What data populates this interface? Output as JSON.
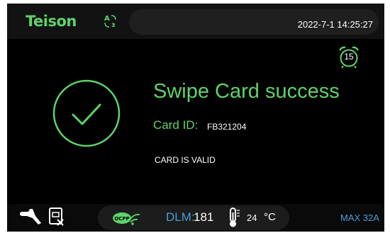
{
  "header": {
    "brand": "Teison",
    "datetime": "2022-7-1 14:25:27",
    "timer": "15",
    "lang_icon": "language-icon"
  },
  "main": {
    "title": "Swipe Card success",
    "card_id_label": "Card ID:",
    "card_id": "FB321204",
    "card_status": "CARD IS VALID",
    "status_icon": "checkmark-circle-icon"
  },
  "footer": {
    "dlm_label": "DLM:",
    "dlm_value": "181",
    "temperature": "24",
    "temp_unit": "°C",
    "max_current": "MAX 32A",
    "icons": [
      "plug-icon",
      "card-slot-icon",
      "ocpp-wifi-icon",
      "thermometer-icon"
    ]
  },
  "colors": {
    "accent_green": "#5fd36a",
    "accent_blue": "#4b9ed8",
    "background": "#000000"
  }
}
